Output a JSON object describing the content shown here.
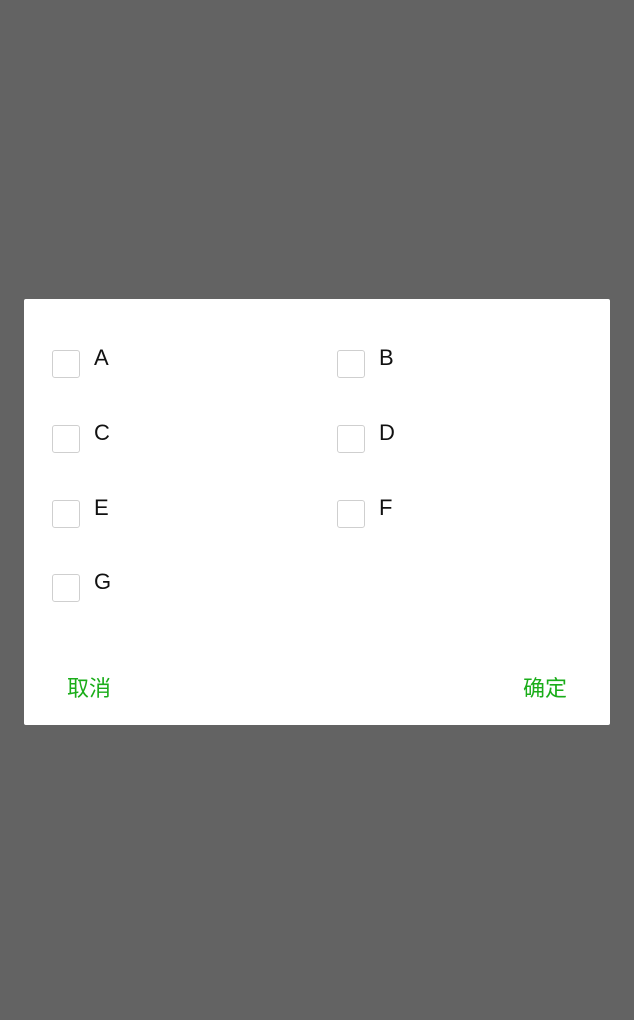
{
  "dialog": {
    "options": [
      {
        "label": "A",
        "checked": false
      },
      {
        "label": "B",
        "checked": false
      },
      {
        "label": "C",
        "checked": false
      },
      {
        "label": "D",
        "checked": false
      },
      {
        "label": "E",
        "checked": false
      },
      {
        "label": "F",
        "checked": false
      },
      {
        "label": "G",
        "checked": false
      }
    ],
    "cancel_label": "取消",
    "confirm_label": "确定"
  },
  "colors": {
    "overlay": "#636363",
    "dialog_background": "#ffffff",
    "accent": "#1aad19",
    "checkbox_border": "#cfcfcf",
    "text": "#111111"
  }
}
